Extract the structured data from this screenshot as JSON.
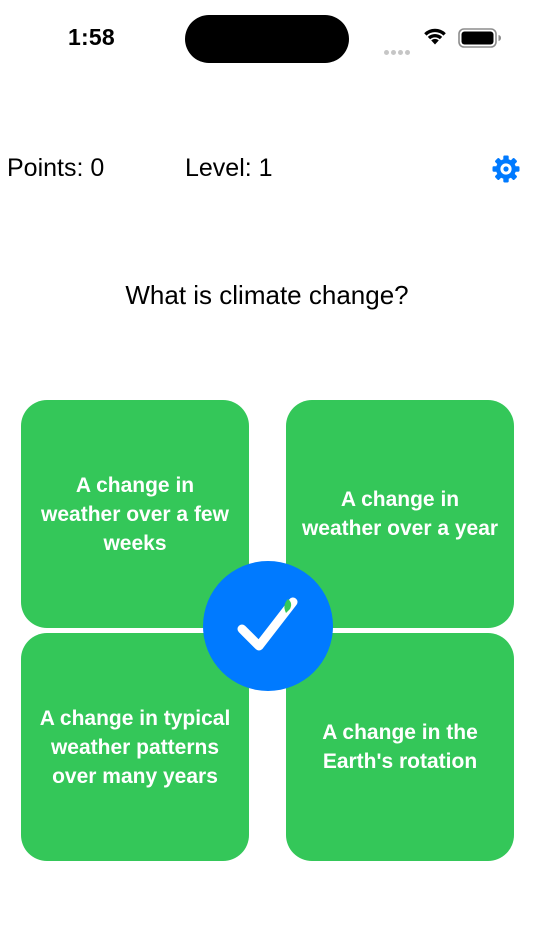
{
  "status_bar": {
    "time": "1:58"
  },
  "header": {
    "points_label": "Points: 0",
    "level_label": "Level: 1",
    "settings_icon": "gear-icon",
    "accent_color": "#007aff"
  },
  "quiz": {
    "question": "What is climate change?",
    "answers": [
      {
        "label": "A change in weather over a few weeks"
      },
      {
        "label": "A change in weather over a year"
      },
      {
        "label": "A change in typical weather patterns over many years"
      },
      {
        "label": "A change in the Earth's rotation"
      }
    ],
    "answer_color": "#34c759",
    "feedback_icon": "checkmark-icon",
    "feedback_color": "#007aff"
  }
}
